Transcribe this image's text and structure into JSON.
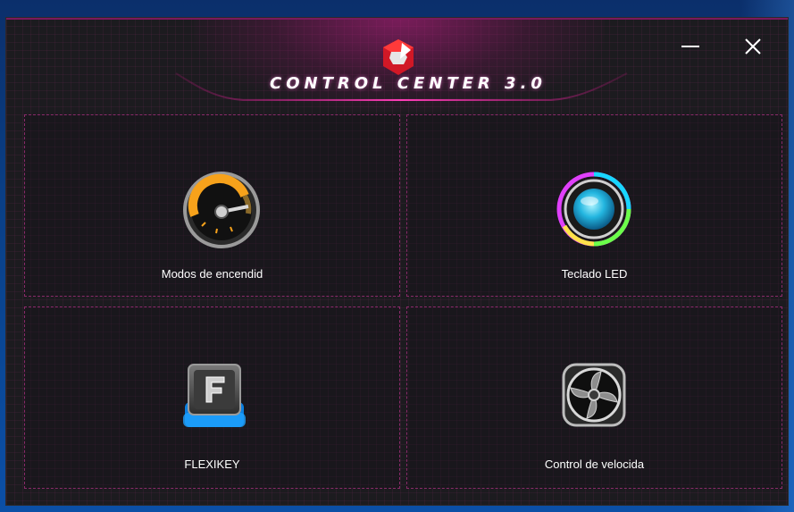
{
  "app": {
    "title": "CONTROL CENTER 3.0",
    "accent_color": "#c3147f"
  },
  "window_controls": {
    "minimize_icon": "minimize-icon",
    "close_icon": "close-icon"
  },
  "tiles": [
    {
      "label": "Modos de encendid",
      "icon": "speedometer-icon"
    },
    {
      "label": "Teclado LED",
      "icon": "rgb-ring-icon"
    },
    {
      "label": "FLEXIKEY",
      "icon": "f-key-icon"
    },
    {
      "label": "Control de velocida",
      "icon": "fan-icon"
    }
  ]
}
